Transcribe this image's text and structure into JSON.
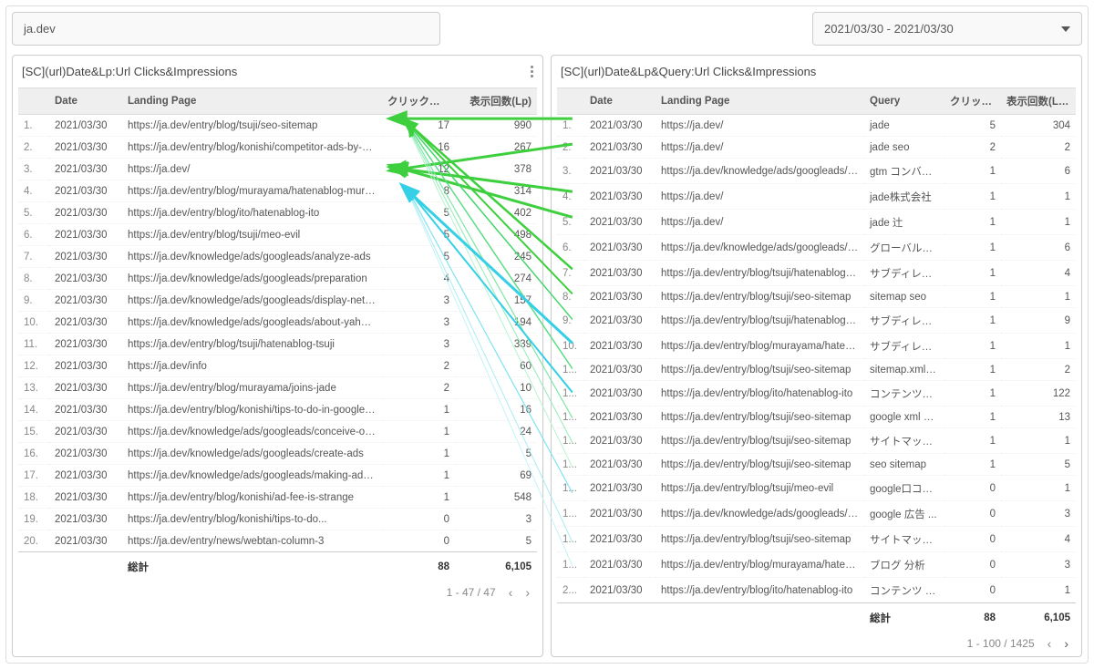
{
  "topbar": {
    "filter_value": "ja.dev",
    "date_range": "2021/03/30 - 2021/03/30"
  },
  "left_panel": {
    "title": "[SC](url)Date&Lp:Url Clicks&Impressions",
    "columns": {
      "idx": "",
      "date": "Date",
      "lp": "Landing Page",
      "clicks": "クリック数(...",
      "impr": "表示回数(Lp)"
    },
    "rows": [
      {
        "i": "1.",
        "date": "2021/03/30",
        "lp": "https://ja.dev/entry/blog/tsuji/seo-sitemap",
        "c": 17,
        "v": 990
      },
      {
        "i": "2.",
        "date": "2021/03/30",
        "lp": "https://ja.dev/entry/blog/konishi/competitor-ads-by-my-...",
        "c": 16,
        "v": 267
      },
      {
        "i": "3.",
        "date": "2021/03/30",
        "lp": "https://ja.dev/",
        "c": 12,
        "v": 378
      },
      {
        "i": "4.",
        "date": "2021/03/30",
        "lp": "https://ja.dev/entry/blog/murayama/hatenablog-muraya...",
        "c": 8,
        "v": 314
      },
      {
        "i": "5.",
        "date": "2021/03/30",
        "lp": "https://ja.dev/entry/blog/ito/hatenablog-ito",
        "c": 5,
        "v": 402
      },
      {
        "i": "6.",
        "date": "2021/03/30",
        "lp": "https://ja.dev/entry/blog/tsuji/meo-evil",
        "c": 5,
        "v": 498
      },
      {
        "i": "7.",
        "date": "2021/03/30",
        "lp": "https://ja.dev/knowledge/ads/googleads/analyze-ads",
        "c": 5,
        "v": 245
      },
      {
        "i": "8.",
        "date": "2021/03/30",
        "lp": "https://ja.dev/knowledge/ads/googleads/preparation",
        "c": 4,
        "v": 274
      },
      {
        "i": "9.",
        "date": "2021/03/30",
        "lp": "https://ja.dev/knowledge/ads/googleads/display-network",
        "c": 3,
        "v": 157
      },
      {
        "i": "10.",
        "date": "2021/03/30",
        "lp": "https://ja.dev/knowledge/ads/googleads/about-yahoo-s...",
        "c": 3,
        "v": 194
      },
      {
        "i": "11.",
        "date": "2021/03/30",
        "lp": "https://ja.dev/entry/blog/tsuji/hatenablog-tsuji",
        "c": 3,
        "v": 339
      },
      {
        "i": "12.",
        "date": "2021/03/30",
        "lp": "https://ja.dev/info",
        "c": 2,
        "v": 60
      },
      {
        "i": "13.",
        "date": "2021/03/30",
        "lp": "https://ja.dev/entry/blog/murayama/joins-jade",
        "c": 2,
        "v": 10
      },
      {
        "i": "14.",
        "date": "2021/03/30",
        "lp": "https://ja.dev/entry/blog/konishi/tips-to-do-in-google-ads",
        "c": 1,
        "v": 16
      },
      {
        "i": "15.",
        "date": "2021/03/30",
        "lp": "https://ja.dev/knowledge/ads/googleads/conceive-of-ke...",
        "c": 1,
        "v": 24
      },
      {
        "i": "16.",
        "date": "2021/03/30",
        "lp": "https://ja.dev/knowledge/ads/googleads/create-ads",
        "c": 1,
        "v": 5
      },
      {
        "i": "17.",
        "date": "2021/03/30",
        "lp": "https://ja.dev/knowledge/ads/googleads/making-ad-gro...",
        "c": 1,
        "v": 69
      },
      {
        "i": "18.",
        "date": "2021/03/30",
        "lp": "https://ja.dev/entry/blog/konishi/ad-fee-is-strange",
        "c": 1,
        "v": 548
      },
      {
        "i": "19.",
        "date": "2021/03/30",
        "lp": "https://ja.dev/entry/blog/konishi/tips-to-do...",
        "c": 0,
        "v": 3
      },
      {
        "i": "20.",
        "date": "2021/03/30",
        "lp": "https://ja.dev/entry/news/webtan-column-3",
        "c": 0,
        "v": 5
      }
    ],
    "totals": {
      "label": "総計",
      "clicks": "88",
      "impr": "6,105"
    },
    "pager": "1 - 47 / 47"
  },
  "right_panel": {
    "title": "[SC](url)Date&Lp&Query:Url Clicks&Impressions",
    "columns": {
      "idx": "",
      "date": "Date",
      "lp": "Landing Page",
      "query": "Query",
      "clicks": "クリック...",
      "impr": "表示回数(Lp..."
    },
    "rows": [
      {
        "i": "1.",
        "date": "2021/03/30",
        "lp": "https://ja.dev/",
        "q": "jade",
        "c": 5,
        "v": 304
      },
      {
        "i": "2.",
        "date": "2021/03/30",
        "lp": "https://ja.dev/",
        "q": "jade seo",
        "c": 2,
        "v": 2
      },
      {
        "i": "3.",
        "date": "2021/03/30",
        "lp": "https://ja.dev/knowledge/ads/googleads/prepa...",
        "q": "gtm コンバー...",
        "c": 1,
        "v": 6
      },
      {
        "i": "4.",
        "date": "2021/03/30",
        "lp": "https://ja.dev/",
        "q": "jade株式会社",
        "c": 1,
        "v": 1
      },
      {
        "i": "5.",
        "date": "2021/03/30",
        "lp": "https://ja.dev/",
        "q": "jade 辻",
        "c": 1,
        "v": 1
      },
      {
        "i": "6.",
        "date": "2021/03/30",
        "lp": "https://ja.dev/knowledge/ads/googleads/prepa...",
        "q": "グローバルサ...",
        "c": 1,
        "v": 6
      },
      {
        "i": "7.",
        "date": "2021/03/30",
        "lp": "https://ja.dev/entry/blog/tsuji/hatenablog-tsuji",
        "q": "サブディレク...",
        "c": 1,
        "v": 4
      },
      {
        "i": "8.",
        "date": "2021/03/30",
        "lp": "https://ja.dev/entry/blog/tsuji/seo-sitemap",
        "q": "sitemap seo",
        "c": 1,
        "v": 1
      },
      {
        "i": "9.",
        "date": "2021/03/30",
        "lp": "https://ja.dev/entry/blog/tsuji/hatenablog-tsuji",
        "q": "サブディレク...",
        "c": 1,
        "v": 9
      },
      {
        "i": "10.",
        "date": "2021/03/30",
        "lp": "https://ja.dev/entry/blog/murayama/hatenablo...",
        "q": "サブディレク...",
        "c": 1,
        "v": 1
      },
      {
        "i": "1...",
        "date": "2021/03/30",
        "lp": "https://ja.dev/entry/blog/tsuji/seo-sitemap",
        "q": "sitemap.xml s...",
        "c": 1,
        "v": 2
      },
      {
        "i": "1...",
        "date": "2021/03/30",
        "lp": "https://ja.dev/entry/blog/ito/hatenablog-ito",
        "q": "コンテンツマ...",
        "c": 1,
        "v": 122
      },
      {
        "i": "1...",
        "date": "2021/03/30",
        "lp": "https://ja.dev/entry/blog/tsuji/seo-sitemap",
        "q": "google xml sit...",
        "c": 1,
        "v": 13
      },
      {
        "i": "1...",
        "date": "2021/03/30",
        "lp": "https://ja.dev/entry/blog/tsuji/seo-sitemap",
        "q": "サイトマップ ...",
        "c": 1,
        "v": 1
      },
      {
        "i": "1...",
        "date": "2021/03/30",
        "lp": "https://ja.dev/entry/blog/tsuji/seo-sitemap",
        "q": "seo sitemap",
        "c": 1,
        "v": 5
      },
      {
        "i": "1...",
        "date": "2021/03/30",
        "lp": "https://ja.dev/entry/blog/tsuji/meo-evil",
        "q": "google口コミ...",
        "c": 0,
        "v": 1
      },
      {
        "i": "1...",
        "date": "2021/03/30",
        "lp": "https://ja.dev/knowledge/ads/googleads/maki...",
        "q": "google 広告 ...",
        "c": 0,
        "v": 3
      },
      {
        "i": "1...",
        "date": "2021/03/30",
        "lp": "https://ja.dev/entry/blog/tsuji/seo-sitemap",
        "q": "サイトマップ...",
        "c": 0,
        "v": 4
      },
      {
        "i": "1...",
        "date": "2021/03/30",
        "lp": "https://ja.dev/entry/blog/murayama/hatenablo...",
        "q": "ブログ 分析",
        "c": 0,
        "v": 3
      },
      {
        "i": "2...",
        "date": "2021/03/30",
        "lp": "https://ja.dev/entry/blog/ito/hatenablog-ito",
        "q": "コンテンツ マ...",
        "c": 0,
        "v": 1
      }
    ],
    "totals": {
      "label": "総計",
      "clicks": "88",
      "impr": "6,105"
    },
    "pager": "1 - 100 / 1425"
  }
}
